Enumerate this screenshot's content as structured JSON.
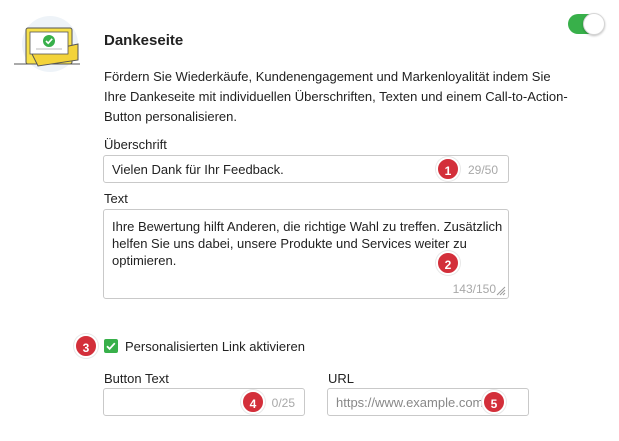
{
  "section": {
    "title": "Dankeseite",
    "description": "Fördern Sie Wiederkäufe, Kundenengagement und Markenloyalität indem Sie Ihre Dankeseite mit individuellen Überschriften, Texten und einem Call-to-Action-Button personalisieren.",
    "enabled": true,
    "illustration_icon": "thank-you-card-icon"
  },
  "headline": {
    "label": "Überschrift",
    "value": "Vielen Dank für Ihr Feedback.",
    "counter": "29/50",
    "badge": "1"
  },
  "text": {
    "label": "Text",
    "value": "Ihre Bewertung hilft Anderen, die richtige Wahl zu treffen. Zusätzlich helfen Sie uns dabei, unsere Produkte und Services weiter zu optimieren.",
    "counter": "143/150",
    "badge": "2"
  },
  "personalized_link": {
    "label": "Personalisierten Link aktivieren",
    "checked": true,
    "badge": "3"
  },
  "button_text": {
    "label": "Button Text",
    "value": "",
    "counter": "0/25",
    "badge": "4"
  },
  "url": {
    "label": "URL",
    "placeholder": "https://www.example.com",
    "badge": "5"
  },
  "colors": {
    "accent_green": "#38b04a",
    "badge_red": "#d32f3a",
    "card_yellow": "#f6e04a"
  }
}
